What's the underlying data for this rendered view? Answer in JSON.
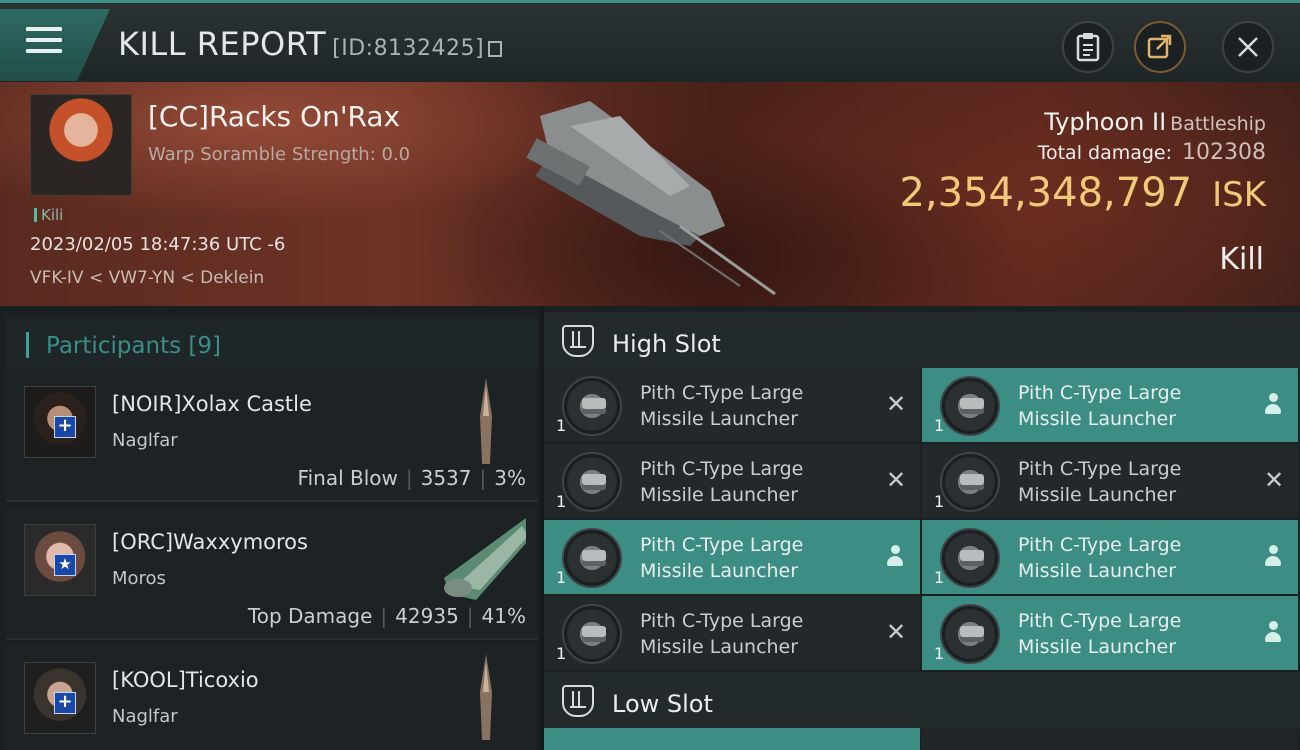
{
  "header": {
    "title": "KILL REPORT",
    "report_id": "[ID:8132425]",
    "accent": "#3c8f86"
  },
  "victim": {
    "name": "[CC]Racks On'Rax",
    "scramble": "Warp Soramble Strength: 0.0",
    "tag": "Kili",
    "date": "2023/02/05 18:47:36 UTC -6",
    "location": "VFK-IV < VW7-YN < Deklein",
    "ship_name": "Typhoon II",
    "ship_class": "Battleship",
    "total_damage_label": "Total damage:",
    "total_damage": "102308",
    "isk_value": "2,354,348,797",
    "isk_unit": "ISK",
    "result": "Kill",
    "isk_color": "#f1c979"
  },
  "participants": {
    "title": "Participants [9]",
    "rows": [
      {
        "name": "[NOIR]Xolax Castle",
        "ship": "Naglfar",
        "label": "Final Blow",
        "damage": "3537",
        "percent": "3%",
        "badge": "+"
      },
      {
        "name": "[ORC]Waxxymoros",
        "ship": "Moros",
        "label": "Top Damage",
        "damage": "42935",
        "percent": "41%",
        "badge": "★"
      },
      {
        "name": "[KOOL]Ticoxio",
        "ship": "Naglfar",
        "label": "",
        "damage": "",
        "percent": "",
        "badge": "+"
      }
    ]
  },
  "slots": {
    "high_title": "High Slot",
    "low_title": "Low Slot",
    "high_modules": [
      {
        "line1": "Pith C-Type Large",
        "line2": "Missile Launcher",
        "qty": "1",
        "status": "destroyed-icon"
      },
      {
        "line1": "Pith C-Type Large",
        "line2": "Missile Launcher",
        "qty": "1",
        "status": "dropped-icon"
      },
      {
        "line1": "Pith C-Type Large",
        "line2": "Missile Launcher",
        "qty": "1",
        "status": "destroyed-icon"
      },
      {
        "line1": "Pith C-Type Large",
        "line2": "Missile Launcher",
        "qty": "1",
        "status": "destroyed-icon"
      },
      {
        "line1": "Pith C-Type Large",
        "line2": "Missile Launcher",
        "qty": "1",
        "status": "dropped-icon"
      },
      {
        "line1": "Pith C-Type Large",
        "line2": "Missile Launcher",
        "qty": "1",
        "status": "dropped-icon"
      },
      {
        "line1": "Pith C-Type Large",
        "line2": "Missile Launcher",
        "qty": "1",
        "status": "destroyed-icon"
      },
      {
        "line1": "Pith C-Type Large",
        "line2": "Missile Launcher",
        "qty": "1",
        "status": "dropped-icon"
      }
    ],
    "fitted_color": "#3c8e85"
  }
}
